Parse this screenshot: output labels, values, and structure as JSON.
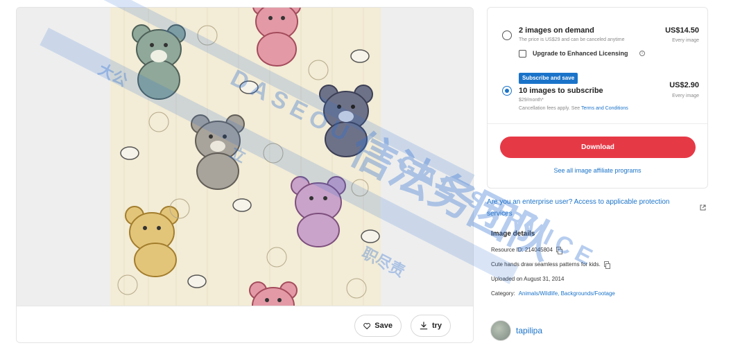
{
  "image_panel": {
    "save_label": "Save",
    "try_label": "try"
  },
  "purchase": {
    "option1": {
      "title": "2 images on demand",
      "subtitle": "The price is US$29 and can be canceled anytime",
      "price": "US$14.50",
      "price_sub": "Every image",
      "upgrade_label": "Upgrade to Enhanced Licensing",
      "selected": false
    },
    "option2": {
      "badge": "Subscribe and save",
      "title": "10 images to subscribe",
      "subtitle": "$29/month*",
      "fees_text": "Cancellation fees apply. See ",
      "fees_link": "Terms and Conditions",
      "price": "US$2.90",
      "price_sub": "Every image",
      "selected": true
    },
    "download_label": "Download",
    "affiliate_link": "See all image affiliate programs"
  },
  "enterprise_text": "Are you an enterprise user? Access to applicable protection services",
  "details": {
    "title": "Image details",
    "resource_id": "Resource ID: 214045804",
    "description": "Cute hands draw seamless patterns for kids.",
    "uploaded": "Uploaded on August 31, 2014",
    "category_label": "Category:",
    "category_value": "Animals/Wildlife, Backgrounds/Footage"
  },
  "author": {
    "name": "tapilipa"
  },
  "watermark": {
    "line1": "DASEOU LEGAL SERVICE",
    "cn1": "大公",
    "cn2": "信法务团队",
    "cn3": "职尽责",
    "cn4": "立"
  },
  "colors": {
    "accent": "#1a73c9",
    "download": "#e63946",
    "pattern_bg": "#f3ecd6"
  }
}
